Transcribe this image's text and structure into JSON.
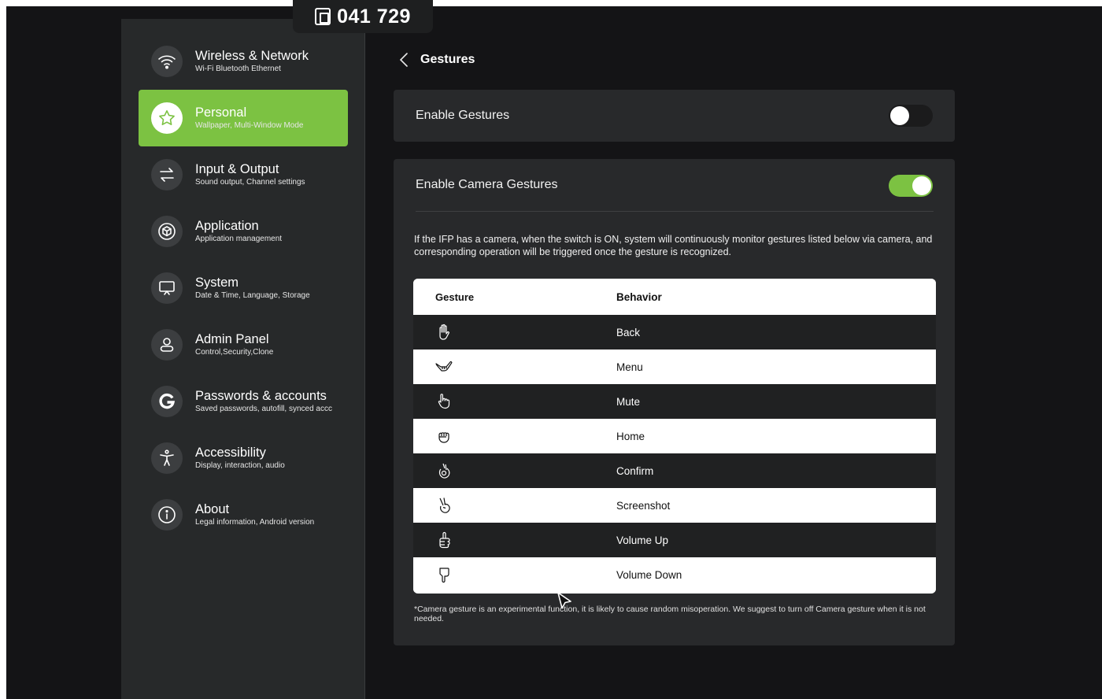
{
  "badge": {
    "code": "041 729",
    "icon": "cast-code-icon"
  },
  "sidebar": {
    "items": [
      {
        "label": "Wireless & Network",
        "sub": "Wi-Fi Bluetooth Ethernet",
        "icon": "wifi-icon"
      },
      {
        "label": "Personal",
        "sub": "Wallpaper, Multi-Window Mode",
        "icon": "star-icon",
        "active": true
      },
      {
        "label": "Input & Output",
        "sub": "Sound output, Channel settings",
        "icon": "swap-arrows-icon"
      },
      {
        "label": "Application",
        "sub": "Application management",
        "icon": "cube-icon"
      },
      {
        "label": "System",
        "sub": "Date & Time, Language, Storage",
        "icon": "presentation-board-icon"
      },
      {
        "label": "Admin Panel",
        "sub": "Control,Security,Clone",
        "icon": "person-icon"
      },
      {
        "label": "Passwords & accounts",
        "sub": "Saved passwords, autofill, synced accc",
        "icon": "google-g-icon"
      },
      {
        "label": "Accessibility",
        "sub": "Display, interaction, audio",
        "icon": "accessibility-icon"
      },
      {
        "label": "About",
        "sub": "Legal information, Android version",
        "icon": "info-icon"
      }
    ]
  },
  "page": {
    "title": "Gestures",
    "back_icon": "chevron-left-icon"
  },
  "enable_gestures": {
    "label": "Enable Gestures",
    "on": false
  },
  "camera_gestures": {
    "label": "Enable Camera Gestures",
    "on": true,
    "description": "If the IFP has a camera, when the switch is ON, system will continuously monitor gestures listed below via camera, and corresponding operation will be triggered once the gesture is recognized."
  },
  "table": {
    "headers": {
      "gesture": "Gesture",
      "behavior": "Behavior"
    },
    "rows": [
      {
        "icon": "open-palm-icon",
        "behavior": "Back"
      },
      {
        "icon": "shaka-hand-icon",
        "behavior": "Menu"
      },
      {
        "icon": "pointing-hand-icon",
        "behavior": "Mute"
      },
      {
        "icon": "fist-icon",
        "behavior": "Home"
      },
      {
        "icon": "ok-hand-icon",
        "behavior": "Confirm"
      },
      {
        "icon": "victory-hand-icon",
        "behavior": "Screenshot"
      },
      {
        "icon": "thumbs-up-icon",
        "behavior": "Volume Up"
      },
      {
        "icon": "thumbs-down-icon",
        "behavior": "Volume Down"
      }
    ]
  },
  "footnote": "*Camera gesture is an experimental function, it is likely to cause random misoperation. We suggest to turn off Camera gesture when it is not needed.",
  "colors": {
    "accent": "#7cc242",
    "sidebar_bg": "#27292a",
    "card_bg": "#28292b",
    "screen_bg": "#141416"
  }
}
